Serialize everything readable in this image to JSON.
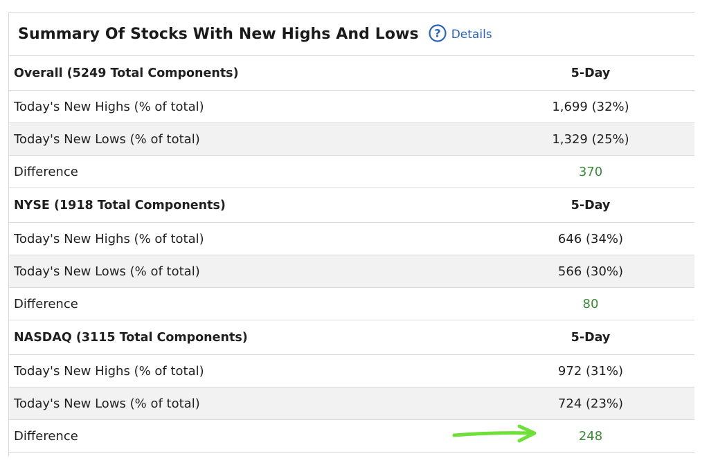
{
  "title": "Summary Of Stocks With New Highs And Lows",
  "details_label": "Details",
  "accent_color": "#2b62b4",
  "positive_color": "#3a8a3a",
  "annotation": {
    "icon": "green-arrow-icon",
    "color": "#6fe03a"
  },
  "sections": [
    {
      "header": "Overall (5249 Total Components)",
      "col_header": "5-Day",
      "rows": [
        {
          "label": "Today's New Highs (% of total)",
          "value": "1,699 (32%)"
        },
        {
          "label": "Today's New Lows (% of total)",
          "value": "1,329 (25%)"
        },
        {
          "label": "Difference",
          "value": "370"
        }
      ]
    },
    {
      "header": "NYSE (1918 Total Components)",
      "col_header": "5-Day",
      "rows": [
        {
          "label": "Today's New Highs (% of total)",
          "value": "646 (34%)"
        },
        {
          "label": "Today's New Lows (% of total)",
          "value": "566 (30%)"
        },
        {
          "label": "Difference",
          "value": "80"
        }
      ]
    },
    {
      "header": "NASDAQ (3115 Total Components)",
      "col_header": "5-Day",
      "rows": [
        {
          "label": "Today's New Highs (% of total)",
          "value": "972 (31%)"
        },
        {
          "label": "Today's New Lows (% of total)",
          "value": "724 (23%)"
        },
        {
          "label": "Difference",
          "value": "248"
        }
      ]
    }
  ]
}
